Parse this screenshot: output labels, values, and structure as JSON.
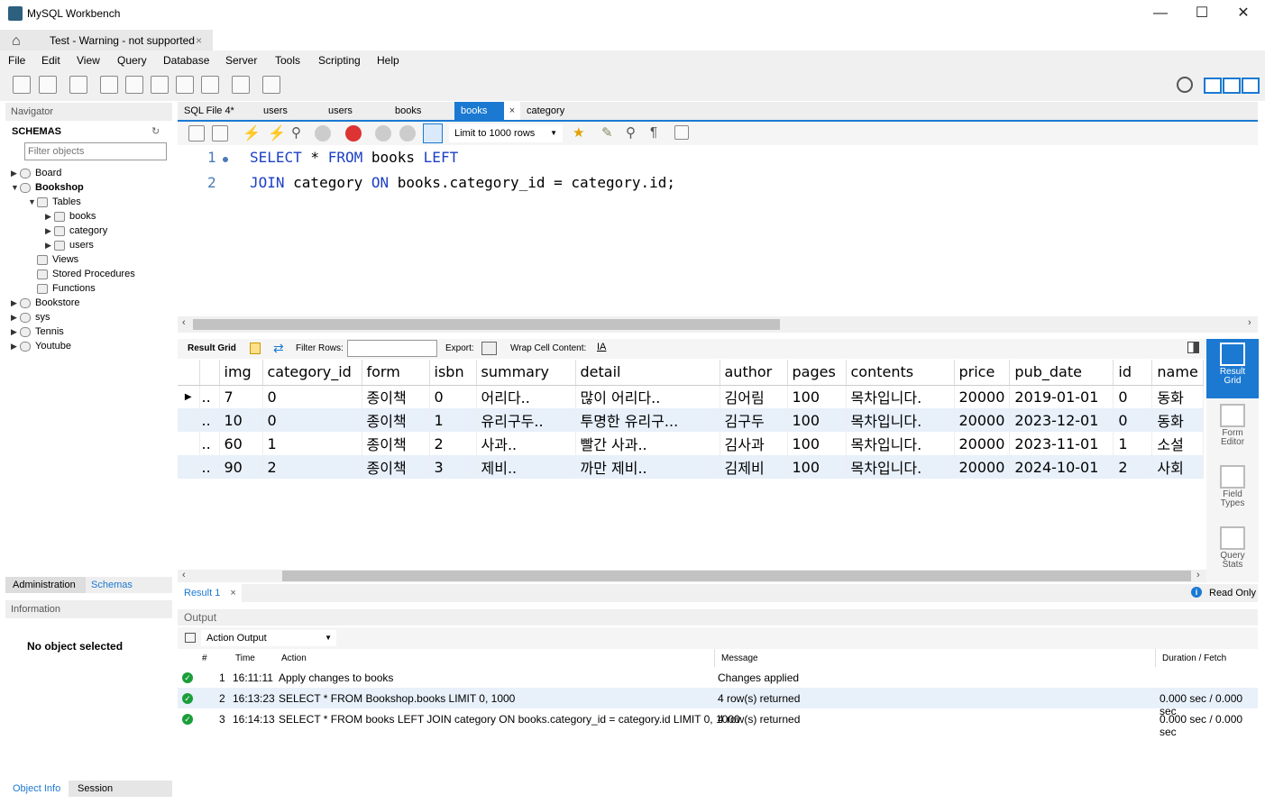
{
  "window": {
    "title": "MySQL Workbench"
  },
  "connection_tab": {
    "label": "Test - Warning - not supported"
  },
  "menu": [
    "File",
    "Edit",
    "View",
    "Query",
    "Database",
    "Server",
    "Tools",
    "Scripting",
    "Help"
  ],
  "navigator": {
    "header": "Navigator",
    "schemas_label": "SCHEMAS",
    "filter_placeholder": "Filter objects",
    "tree": [
      {
        "label": "Board",
        "depth": 0,
        "expanded": false,
        "bold": false
      },
      {
        "label": "Bookshop",
        "depth": 0,
        "expanded": true,
        "bold": true
      },
      {
        "label": "Tables",
        "depth": 1,
        "expanded": true,
        "bold": false
      },
      {
        "label": "books",
        "depth": 2,
        "expanded": false,
        "bold": false
      },
      {
        "label": "category",
        "depth": 2,
        "expanded": false,
        "bold": false
      },
      {
        "label": "users",
        "depth": 2,
        "expanded": false,
        "bold": false
      },
      {
        "label": "Views",
        "depth": 1,
        "expanded": null,
        "bold": false
      },
      {
        "label": "Stored Procedures",
        "depth": 1,
        "expanded": null,
        "bold": false
      },
      {
        "label": "Functions",
        "depth": 1,
        "expanded": null,
        "bold": false
      },
      {
        "label": "Bookstore",
        "depth": 0,
        "expanded": false,
        "bold": false
      },
      {
        "label": "sys",
        "depth": 0,
        "expanded": false,
        "bold": false
      },
      {
        "label": "Tennis",
        "depth": 0,
        "expanded": false,
        "bold": false
      },
      {
        "label": "Youtube",
        "depth": 0,
        "expanded": false,
        "bold": false
      }
    ],
    "bottom_tabs": [
      "Administration",
      "Schemas"
    ],
    "info_header": "Information",
    "no_object": "No object selected",
    "info_tabs": [
      "Object Info",
      "Session"
    ]
  },
  "sql_tabs": [
    {
      "label": "SQL File 4*",
      "active": false
    },
    {
      "label": "users",
      "active": false
    },
    {
      "label": "users",
      "active": false
    },
    {
      "label": "books",
      "active": false
    },
    {
      "label": "books",
      "active": true
    },
    {
      "label": "category",
      "active": false
    }
  ],
  "editor": {
    "limit_label": "Limit to 1000 rows",
    "lines": [
      {
        "num": "1",
        "parts": [
          [
            "kw",
            "SELECT"
          ],
          [
            "t",
            " * "
          ],
          [
            "kw",
            "FROM"
          ],
          [
            "t",
            " books "
          ],
          [
            "kw",
            "LEFT"
          ]
        ]
      },
      {
        "num": "2",
        "parts": [
          [
            "kw",
            "JOIN"
          ],
          [
            "t",
            " category "
          ],
          [
            "kw",
            "ON"
          ],
          [
            "t",
            " books.category_id = category.id;"
          ]
        ]
      }
    ]
  },
  "result_toolbar": {
    "result_grid": "Result Grid",
    "filter_rows": "Filter Rows:",
    "export": "Export:",
    "wrap": "Wrap Cell Content:"
  },
  "grid": {
    "columns": [
      "img",
      "category_id",
      "form",
      "isbn",
      "summary",
      "detail",
      "author",
      "pages",
      "contents",
      "price",
      "pub_date",
      "id",
      "name"
    ],
    "rows": [
      [
        "7",
        "0",
        "종이책",
        "0",
        "어리다..",
        "많이 어리다..",
        "김어림",
        "100",
        "목차입니다.",
        "20000",
        "2019-01-01",
        "0",
        "동화"
      ],
      [
        "10",
        "0",
        "종이책",
        "1",
        "유리구두..",
        "투명한 유리구...",
        "김구두",
        "100",
        "목차입니다.",
        "20000",
        "2023-12-01",
        "0",
        "동화"
      ],
      [
        "60",
        "1",
        "종이책",
        "2",
        "사과..",
        "빨간 사과..",
        "김사과",
        "100",
        "목차입니다.",
        "20000",
        "2023-11-01",
        "1",
        "소설"
      ],
      [
        "90",
        "2",
        "종이책",
        "3",
        "제비..",
        "까만 제비..",
        "김제비",
        "100",
        "목차입니다.",
        "20000",
        "2024-10-01",
        "2",
        "사회"
      ]
    ]
  },
  "side_buttons": [
    {
      "label": "Result Grid",
      "active": true
    },
    {
      "label": "Form Editor",
      "active": false
    },
    {
      "label": "Field Types",
      "active": false
    },
    {
      "label": "Query Stats",
      "active": false
    }
  ],
  "result_tab": "Result 1",
  "read_only": "Read Only",
  "output": {
    "header": "Output",
    "mode": "Action Output",
    "columns": [
      "#",
      "Time",
      "Action",
      "Message",
      "Duration / Fetch"
    ],
    "rows": [
      {
        "n": "1",
        "time": "16:11:11",
        "action": "Apply changes to books",
        "message": "Changes applied",
        "duration": ""
      },
      {
        "n": "2",
        "time": "16:13:23",
        "action": "SELECT * FROM Bookshop.books LIMIT 0, 1000",
        "message": "4 row(s) returned",
        "duration": "0.000 sec / 0.000 sec"
      },
      {
        "n": "3",
        "time": "16:14:13",
        "action": "SELECT * FROM books LEFT JOIN category ON books.category_id = category.id LIMIT 0, 1000",
        "message": "4 row(s) returned",
        "duration": "0.000 sec / 0.000 sec"
      }
    ]
  },
  "colors": {
    "accent": "#1b79d2",
    "keyword": "#1b3fc6",
    "success": "#1a9e3a"
  }
}
